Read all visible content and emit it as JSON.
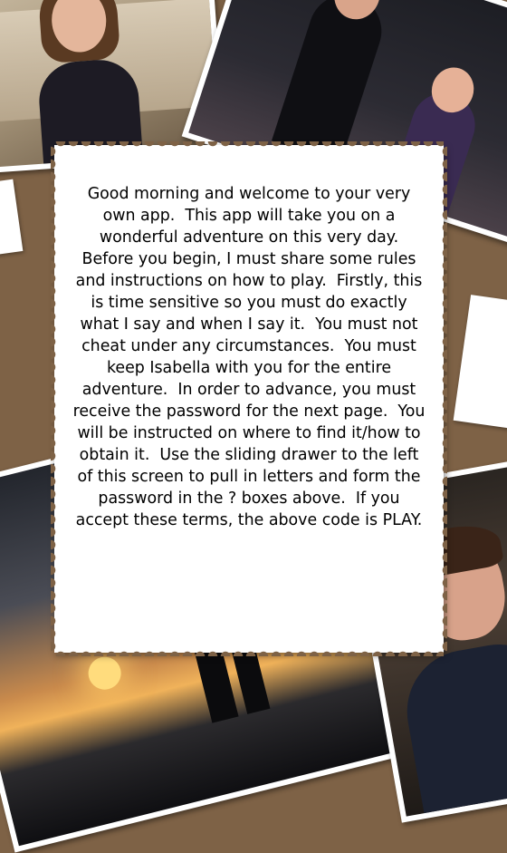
{
  "instructions": {
    "text": "Good morning and welcome to your very own app.  This app will take you on a wonderful adventure on this very day.  Before you begin, I must share some rules and instructions on how to play.  Firstly, this is time sensitive so you must do exactly what I say and when I say it.  You must not cheat under any circumstances.  You must keep Isabella with you for the entire adventure.  In order to advance, you must receive the password for the next page.  You will be instructed on where to find it/how to obtain it.  Use the sliding drawer to the left of this screen to pull in letters and form the password in the ? boxes above.  If you accept these terms, the above code is PLAY."
  },
  "colors": {
    "background": "#7e6246",
    "card": "#ffffff",
    "text": "#000000"
  },
  "photos": [
    {
      "name": "girl-on-couch-photo"
    },
    {
      "name": "dancing-couple-photo"
    },
    {
      "name": "sunset-couple-photo"
    },
    {
      "name": "smiling-guy-photo"
    }
  ]
}
